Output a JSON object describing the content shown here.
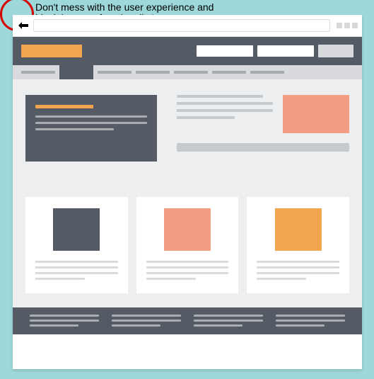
{
  "callout": {
    "text": "Don't mess with the user experience and\nblock browser functionality!"
  }
}
